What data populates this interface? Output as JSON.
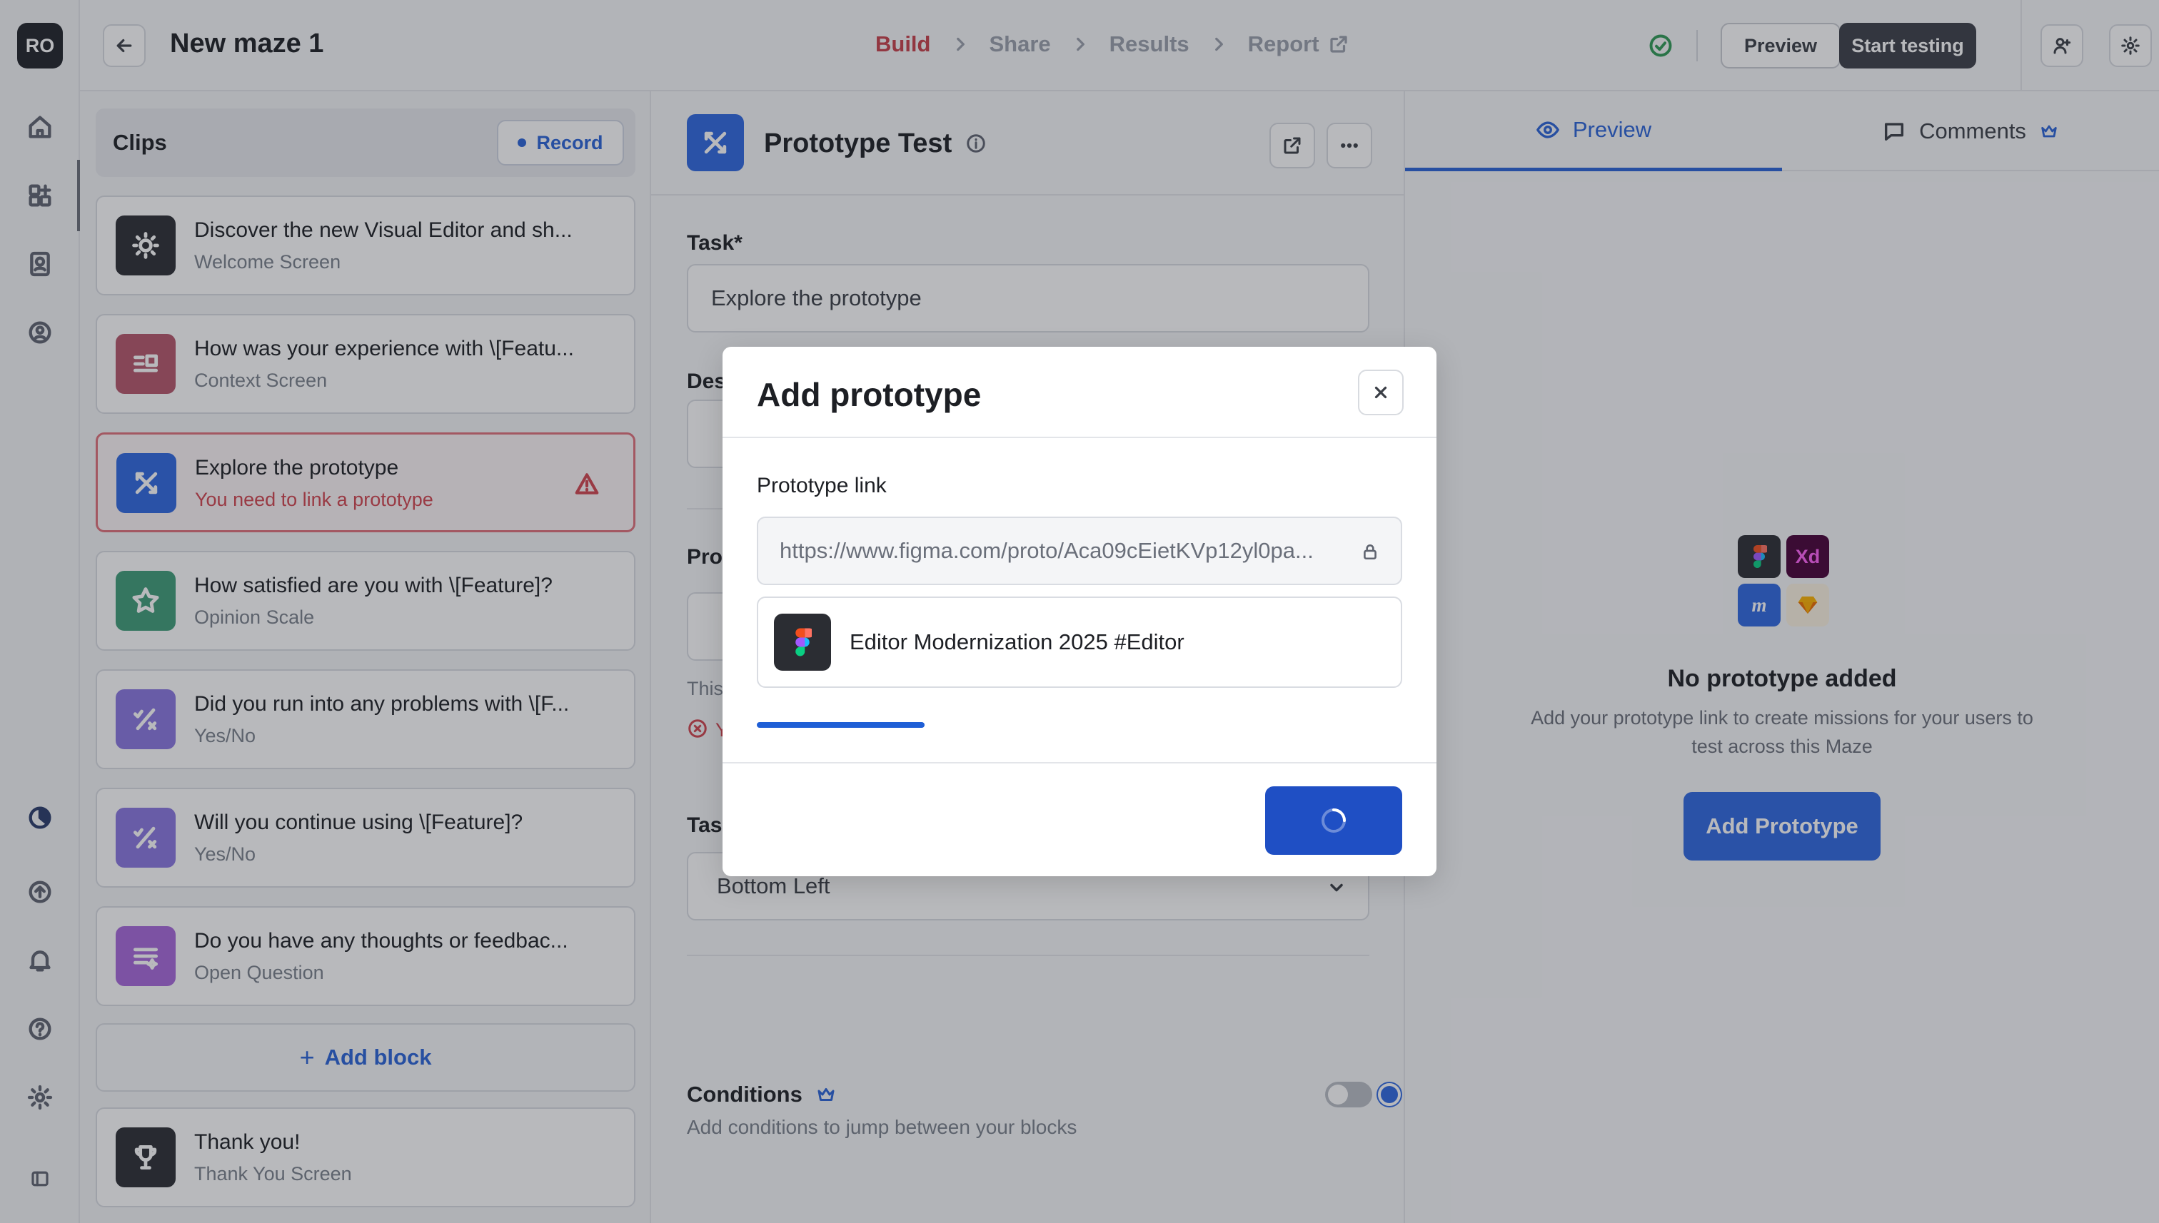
{
  "user": {
    "initials": "RO"
  },
  "topbar": {
    "title": "New maze 1",
    "steps": [
      "Build",
      "Share",
      "Results",
      "Report"
    ],
    "preview_label": "Preview",
    "start_label": "Start testing"
  },
  "clips": {
    "title": "Clips",
    "record_label": "Record",
    "blocks": [
      {
        "title": "Discover the new Visual Editor and sh...",
        "subtitle": "Welcome Screen",
        "icon": "sun-icon",
        "color": "#2b2d33"
      },
      {
        "title": "How was your experience with \\[Featu...",
        "subtitle": "Context Screen",
        "icon": "context-icon",
        "color": "#b5566a"
      },
      {
        "title": "Explore the prototype",
        "subtitle": "You need to link a prototype",
        "icon": "prototype-icon",
        "color": "#2f68e0"
      },
      {
        "title": "How satisfied are you with \\[Feature]?",
        "subtitle": "Opinion Scale",
        "icon": "star-icon",
        "color": "#3f9d78"
      },
      {
        "title": "Did you run into any problems with \\[F...",
        "subtitle": "Yes/No",
        "icon": "yes-no-icon",
        "color": "#8a76e0"
      },
      {
        "title": "Will you continue using \\[Feature]?",
        "subtitle": "Yes/No",
        "icon": "yes-no-icon",
        "color": "#8a76e0"
      },
      {
        "title": "Do you have any thoughts or feedbac...",
        "subtitle": "Open Question",
        "icon": "text-icon",
        "color": "#a768db"
      }
    ],
    "add_block_label": "Add block",
    "thankyou": {
      "title": "Thank you!",
      "subtitle": "Thank You Screen",
      "icon": "trophy-icon",
      "color": "#2b2d33"
    }
  },
  "block_editor": {
    "title": "Prototype Test",
    "task_label": "Task*",
    "task_value": "Explore the prototype",
    "desc_label_partial": "Des",
    "proto_label_partial": "Pro",
    "helper_partial": "This",
    "error_partial": "Y",
    "task_label_partial": "Tas",
    "position_value": "Bottom Left",
    "conditions_title": "Conditions",
    "conditions_sub": "Add conditions to jump between your blocks"
  },
  "preview_panel": {
    "tabs": [
      "Preview",
      "Comments"
    ],
    "tool_xd_label": "Xd",
    "tool_marvel_label": "m",
    "empty_title": "No prototype added",
    "empty_sub": "Add your prototype link to create missions for your users to test across this Maze",
    "add_button": "Add Prototype"
  },
  "modal": {
    "title": "Add prototype",
    "link_label": "Prototype link",
    "link_value": "https://www.figma.com/proto/Aca09cEietKVp12yl0pa...",
    "file_name": "Editor Modernization 2025 #Editor",
    "progress": 0.26
  },
  "colors": {
    "accent": "#2a63d8",
    "danger": "#d2444f",
    "success": "#2f9a55"
  }
}
